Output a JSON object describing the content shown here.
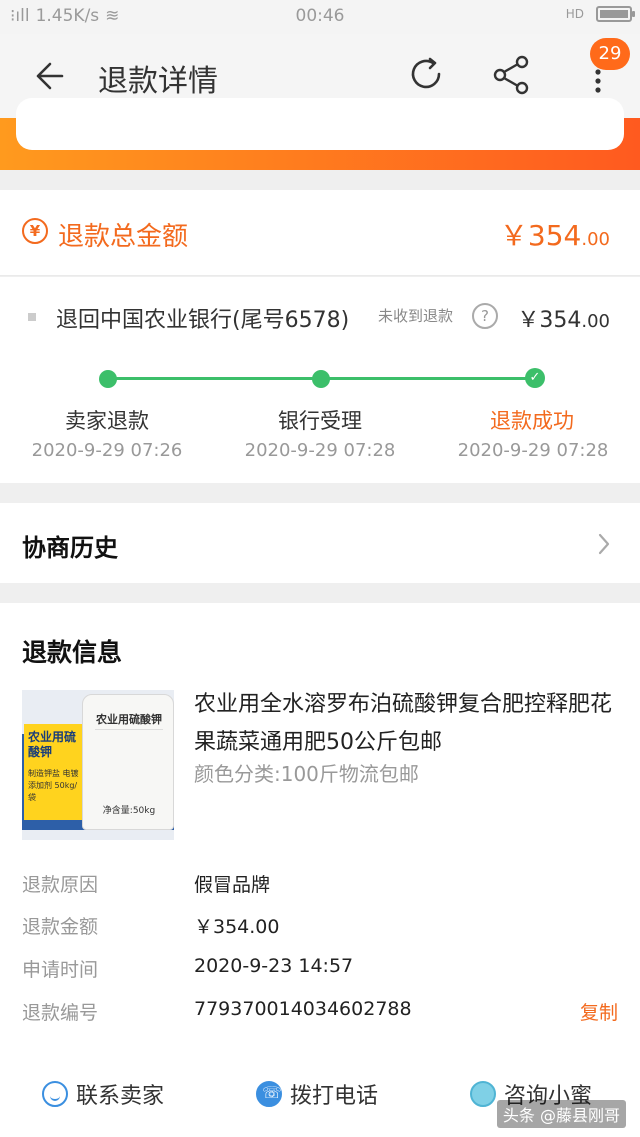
{
  "status_bar": {
    "network": "1.45K/s",
    "time": "00:46",
    "hd": "HD"
  },
  "header": {
    "title": "退款详情",
    "notification_count": "29"
  },
  "refund_total": {
    "label": "退款总金额",
    "amount_main": "￥354",
    "amount_decimal": ".00"
  },
  "refund_destination": {
    "label": "退回中国农业银行(尾号6578)",
    "note": "未收到退款",
    "amount_main": "￥354",
    "amount_decimal": ".00"
  },
  "progress": {
    "steps": [
      {
        "label": "卖家退款",
        "time": "2020-9-29 07:26"
      },
      {
        "label": "银行受理",
        "time": "2020-9-29 07:28"
      },
      {
        "label": "退款成功",
        "time": "2020-9-29 07:28"
      }
    ]
  },
  "history": {
    "label": "协商历史"
  },
  "refund_info": {
    "title": "退款信息",
    "product": {
      "name": "农业用全水溶罗布泊硫酸钾复合肥控释肥花果蔬菜通用肥50公斤包邮",
      "sku": "颜色分类:100斤物流包邮",
      "image_text": {
        "yellow_title": "农业用硫酸钾",
        "yellow_sub": "制造钾盐 电镀添加剂 50kg/袋",
        "bag_title": "农业用硫酸钾",
        "bag_weight": "净含量:50kg"
      }
    },
    "rows": [
      {
        "label": "退款原因",
        "value": "假冒品牌"
      },
      {
        "label": "退款金额",
        "value": "￥354.00"
      },
      {
        "label": "申请时间",
        "value": "2020-9-23 14:57"
      },
      {
        "label": "退款编号",
        "value": "779370014034602788"
      }
    ],
    "copy_label": "复制"
  },
  "bottom_bar": {
    "contact_seller": "联系卖家",
    "call": "拨打电话",
    "consult": "咨询小蜜"
  },
  "watermark": "头条 @藤县刚哥",
  "colors": {
    "accent_orange": "#f36a1e",
    "progress_green": "#3cbf6a",
    "link_blue": "#3b8fe0"
  }
}
